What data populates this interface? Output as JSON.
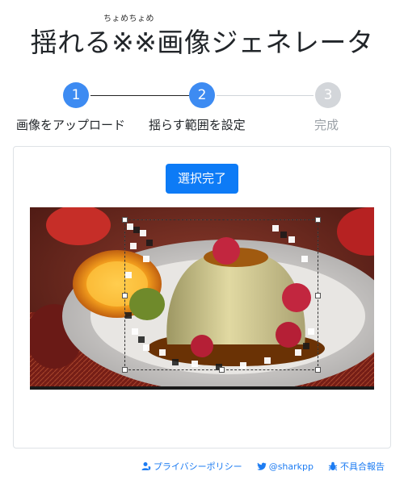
{
  "header": {
    "ruby": "ちょめちょめ",
    "title": "揺れる※※画像ジェネレータ"
  },
  "steps": [
    {
      "number": "1",
      "label": "画像をアップロード"
    },
    {
      "number": "2",
      "label": "揺らす範囲を設定"
    },
    {
      "number": "3",
      "label": "完成"
    }
  ],
  "main": {
    "confirm_button": "選択完了"
  },
  "footer": {
    "privacy": "プライバシーポリシー",
    "twitter": "@sharkpp",
    "report": "不具合報告"
  },
  "colors": {
    "accent": "#3d8bf2",
    "button": "#0d7bf6",
    "inactive": "#d3d6da"
  }
}
